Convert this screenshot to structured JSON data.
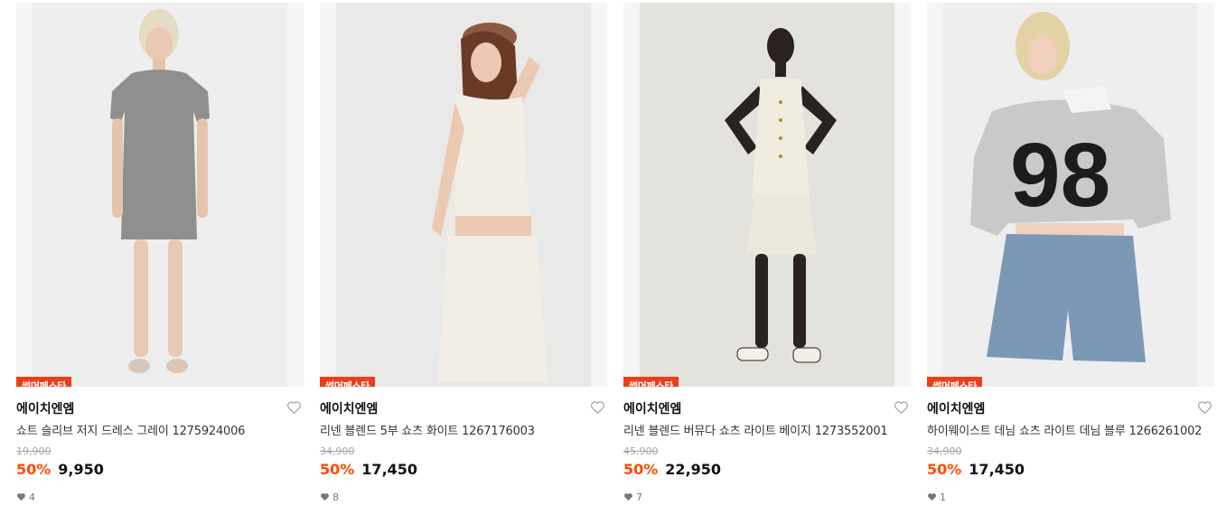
{
  "products": [
    {
      "badge": "썸머페스타",
      "brand": "에이치엔엠",
      "name": "쇼트 슬리브 저지 드레스 그레이 1275924006",
      "original_price": "19,900",
      "discount": "50%",
      "price": "9,950",
      "likes": "4",
      "image": "model-gray-jersey-dress",
      "bg_color": "#ececec"
    },
    {
      "badge": "썸머페스타",
      "brand": "에이치엔엠",
      "name": "리넨 블렌드 5부 쇼츠 화이트 1267176003",
      "original_price": "34,900",
      "discount": "50%",
      "price": "17,450",
      "likes": "8",
      "image": "model-white-linen-shorts",
      "bg_color": "#e7e7e5"
    },
    {
      "badge": "썸머페스타",
      "brand": "에이치엔엠",
      "name": "리넨 블렌드 버뮤다 쇼츠 라이트 베이지 1273552001",
      "original_price": "45,900",
      "discount": "50%",
      "price": "22,950",
      "likes": "7",
      "image": "model-beige-vest-bermuda",
      "bg_color": "#e2e1dc"
    },
    {
      "badge": "썸머페스타",
      "brand": "에이치엔엠",
      "name": "하이웨이스트 데님 쇼츠 라이트 데님 블루 1266261002",
      "original_price": "34,900",
      "discount": "50%",
      "price": "17,450",
      "likes": "1",
      "image": "model-denim-shorts-98-sweatshirt",
      "bg_color": "#ededed"
    }
  ],
  "colors": {
    "badge": "#e8401c",
    "discount": "#ff4a00",
    "strike": "#a6a6a6"
  }
}
